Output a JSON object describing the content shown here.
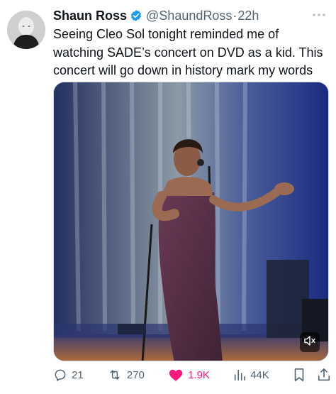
{
  "post": {
    "author_name": "Shaun Ross",
    "handle": "@ShaundRoss",
    "separator": "·",
    "time": "22h",
    "text": "Seeing Cleo Sol tonight reminded me of watching SADE’s concert on DVD as a kid. This concert will go down in history mark my words"
  },
  "actions": {
    "replies": "21",
    "reposts": "270",
    "likes": "1.9K",
    "views": "44K"
  },
  "colors": {
    "verified": "#1d9bf0",
    "liked": "#f91880",
    "secondary_text": "#536471"
  },
  "icons": [
    "more-icon",
    "verified-badge-icon",
    "reply-icon",
    "repost-icon",
    "like-icon",
    "views-icon",
    "bookmark-icon",
    "share-icon",
    "mute-icon"
  ]
}
